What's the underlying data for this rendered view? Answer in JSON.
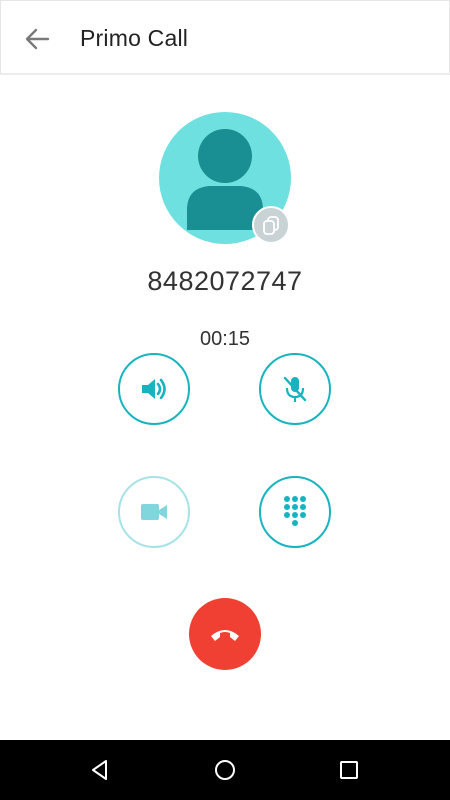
{
  "app_bar": {
    "title": "Primo Call",
    "back_icon": "arrow-left-icon"
  },
  "call": {
    "phone_number": "8482072747",
    "duration": "00:15",
    "avatar_icon": "person-icon",
    "badge_icon": "copy-icon"
  },
  "controls": {
    "speaker": {
      "icon": "speaker-icon",
      "enabled": true
    },
    "mute": {
      "icon": "mic-off-icon",
      "enabled": true
    },
    "video": {
      "icon": "video-camera-icon",
      "enabled": false
    },
    "dialpad": {
      "icon": "dialpad-icon",
      "enabled": true
    },
    "end_call": {
      "icon": "hang-up-icon"
    }
  },
  "nav_bar": {
    "items": [
      "back-triangle-icon",
      "home-circle-icon",
      "recents-square-icon"
    ]
  },
  "colors": {
    "accent": "#17b4c0",
    "accent_disabled": "#a6e3e8",
    "avatar_bg": "#6ee0df",
    "avatar_fg": "#1a8f93",
    "end_call": "#f04033",
    "nav_bar": "#000000"
  }
}
